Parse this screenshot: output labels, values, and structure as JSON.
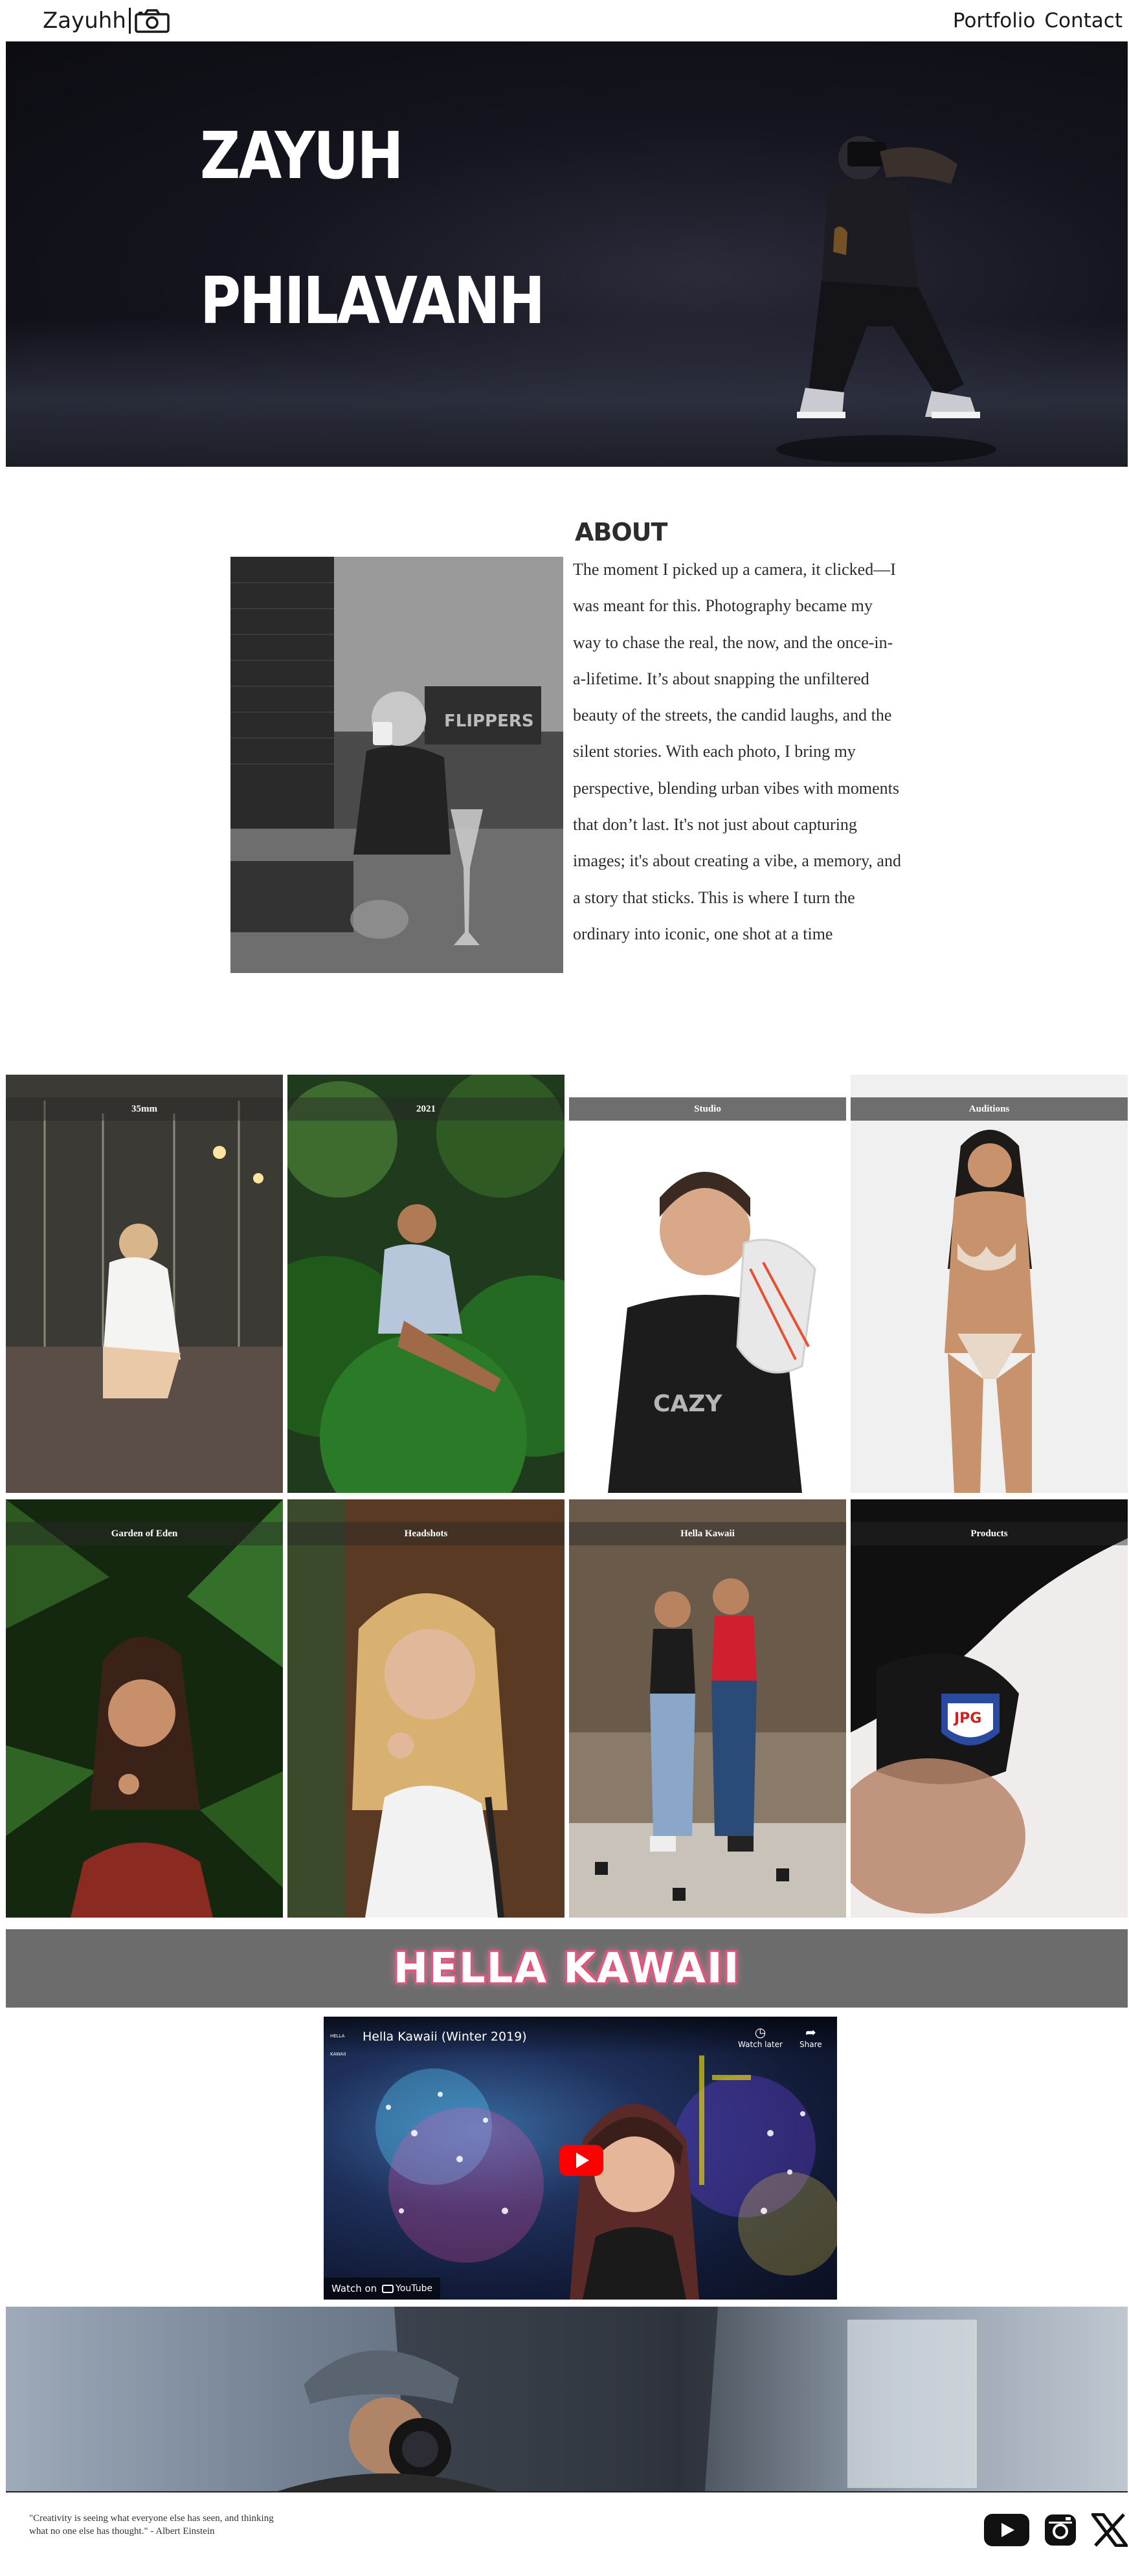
{
  "header": {
    "brand": "Zayuhh",
    "brand_icon": "camera-icon",
    "nav": [
      "Portfolio",
      "Contact"
    ]
  },
  "hero": {
    "first_name": "ZAYUH",
    "last_name": "PHILAVANH"
  },
  "about": {
    "title": "ABOUT",
    "text": "The moment I picked up a camera, it clicked—I was meant for this. Photography became my way to chase the real, the now, and the once-in-a-lifetime. It’s about snapping the unfiltered beauty of the streets, the candid laughs, and the silent stories. With each photo, I bring my perspective, blending urban vibes with moments that don’t last. It's not just about capturing images; it's about creating a vibe, a memory, and a story that sticks. This is where I turn the ordinary into iconic, one shot at a time"
  },
  "gallery": [
    {
      "label": "35mm"
    },
    {
      "label": "2021"
    },
    {
      "label": "Studio"
    },
    {
      "label": "Auditions"
    },
    {
      "label": "Garden of Eden"
    },
    {
      "label": "Headshots"
    },
    {
      "label": "Hella Kawaii"
    },
    {
      "label": "Products"
    }
  ],
  "banner": {
    "title": "HELLA KAWAII"
  },
  "video": {
    "title": "Hella Kawaii (Winter 2019)",
    "channel": "HELLA KAWAII",
    "watch_later": "Watch later",
    "share": "Share",
    "watch_on": "Watch on",
    "platform": "YouTube"
  },
  "footer": {
    "quote": "\"Creativity is seeing what everyone else has seen, and thinking what no one else has thought.\" - Albert Einstein",
    "socials": [
      "youtube-icon",
      "instagram-icon",
      "x-icon"
    ]
  },
  "colors": {
    "banner_bg": "#6c6c6c",
    "banner_glow": "#e2557c",
    "play_button": "#ff0000",
    "hero_bg": "#15151f"
  }
}
